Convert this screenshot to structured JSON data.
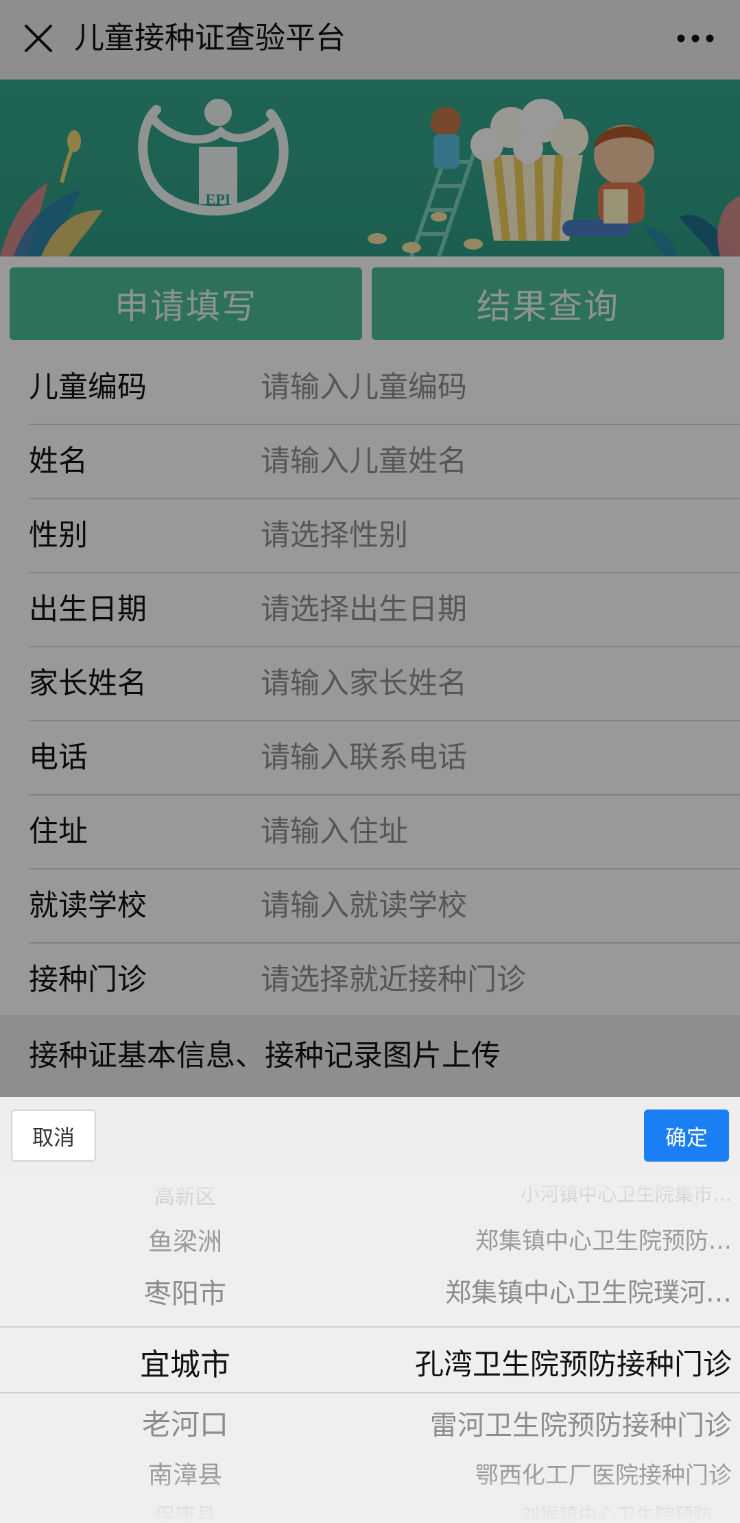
{
  "app": {
    "title": "儿童接种证查验平台"
  },
  "banner": {
    "logo_text": "EPI"
  },
  "tabs": {
    "apply_label": "申请填写",
    "query_label": "结果查询"
  },
  "form": {
    "rows": [
      {
        "label": "儿童编码",
        "placeholder": "请输入儿童编码",
        "kind": "input"
      },
      {
        "label": "姓名",
        "placeholder": "请输入儿童姓名",
        "kind": "input"
      },
      {
        "label": "性别",
        "placeholder": "请选择性别",
        "kind": "select"
      },
      {
        "label": "出生日期",
        "placeholder": "请选择出生日期",
        "kind": "select"
      },
      {
        "label": "家长姓名",
        "placeholder": "请输入家长姓名",
        "kind": "input"
      },
      {
        "label": "电话",
        "placeholder": "请输入联系电话",
        "kind": "input"
      },
      {
        "label": "住址",
        "placeholder": "请输入住址",
        "kind": "input"
      },
      {
        "label": "就读学校",
        "placeholder": "请输入就读学校",
        "kind": "input"
      },
      {
        "label": "接种门诊",
        "placeholder": "请选择就近接种门诊",
        "kind": "select"
      }
    ],
    "upload_label": "接种证基本信息、接种记录图片上传"
  },
  "picker": {
    "cancel_label": "取消",
    "confirm_label": "确定",
    "districts": [
      "高新区",
      "鱼梁洲",
      "枣阳市",
      "宜城市",
      "老河口",
      "南漳县",
      "保康县"
    ],
    "clinics": [
      "小河镇中心卫生院集市…",
      "郑集镇中心卫生院预防…",
      "郑集镇中心卫生院璞河…",
      "孔湾卫生院预防接种门诊",
      "雷河卫生院预防接种门诊",
      "鄂西化工厂医院接种门诊",
      "刘猴镇中心卫生院预防…"
    ],
    "selected_index": 3
  },
  "colors": {
    "accent_green": "#4ebd97",
    "banner_green": "#35a78c",
    "confirm_blue": "#1a7ff5"
  }
}
